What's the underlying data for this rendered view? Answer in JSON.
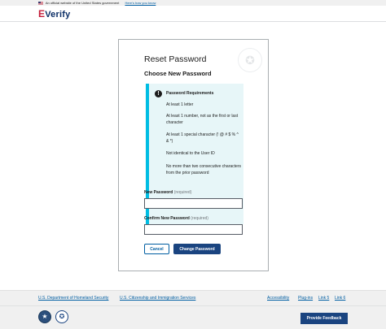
{
  "gov_banner": {
    "text": "An official website of the United States government",
    "link": "Here's how you know"
  },
  "header": {
    "logo_mark": "E",
    "logo_text": "Verify"
  },
  "card": {
    "title": "Reset Password",
    "subtitle": "Choose New Password",
    "requirements": {
      "heading": "Password Requirements",
      "items": [
        "At least 1 letter",
        "At least 1 number, not as the first or last character",
        "At least 1 special character (! @ # $ % ^ & *)",
        "Not identical to the User ID",
        "No more than two consecutive characters from the prior password"
      ]
    },
    "new_password": {
      "label": "New Password",
      "required": "(required)",
      "value": ""
    },
    "confirm_password": {
      "label": "Confirm New Password",
      "required": "(required)",
      "value": ""
    },
    "cancel_label": "Cancel",
    "change_label": "Change Password"
  },
  "footer": {
    "links": [
      "U.S. Department of Homeland Security",
      "U.S. Citizenship and Immigration Services",
      "Accessibility",
      "Plug-ins",
      "Link 5",
      "Link 6"
    ],
    "feedback_label": "Provide Feedback"
  },
  "icons": {
    "alert": "!",
    "seal_dhs": "★",
    "seal_uscis": "✪",
    "watermark": "✪"
  },
  "colors": {
    "primary": "#1a4480",
    "link": "#005ea2",
    "info_border": "#00bde3",
    "info_bg": "#e7f6f8"
  }
}
